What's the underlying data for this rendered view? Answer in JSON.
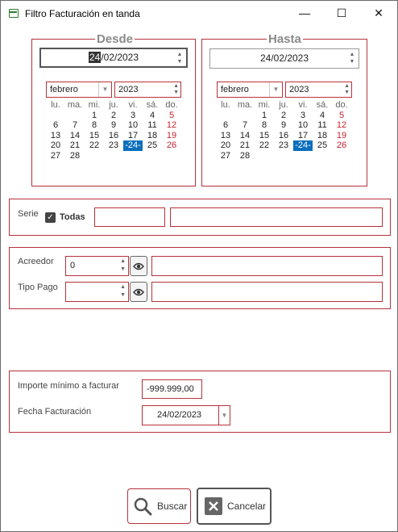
{
  "window": {
    "title": "Filtro Facturación en tanda",
    "minimize_glyph": "—",
    "maximize_glyph": "☐",
    "close_glyph": "✕"
  },
  "desde": {
    "legend": "Desde",
    "date_day": "24",
    "date_rest": "/02/2023",
    "month": "febrero",
    "year": "2023",
    "selected_day": "-24-"
  },
  "hasta": {
    "legend": "Hasta",
    "date": "24/02/2023",
    "month": "febrero",
    "year": "2023",
    "selected_day": "-24-"
  },
  "calendar": {
    "weekdays": [
      "lu.",
      "ma.",
      "mi.",
      "ju.",
      "vi.",
      "sá.",
      "do."
    ],
    "weeks": [
      [
        "",
        "",
        "1",
        "2",
        "3",
        "4",
        "5"
      ],
      [
        "6",
        "7",
        "8",
        "9",
        "10",
        "11",
        "12"
      ],
      [
        "13",
        "14",
        "15",
        "16",
        "17",
        "18",
        "19"
      ],
      [
        "20",
        "21",
        "22",
        "23",
        "24",
        "25",
        "26"
      ],
      [
        "27",
        "28",
        "",
        "",
        "",
        "",
        ""
      ]
    ],
    "sunday_color": "#c8202d",
    "today_color": "#0a6ebd"
  },
  "serie": {
    "label": "Serie",
    "checkbox_label": "Todas",
    "checked": true,
    "code_value": "",
    "name_value": ""
  },
  "acreedor": {
    "label": "Acreedor",
    "value": "0",
    "name_value": ""
  },
  "tipo_pago": {
    "label": "Tipo Pago",
    "value": "",
    "name_value": ""
  },
  "importe": {
    "label": "Importe mínimo a facturar",
    "value": "-999.999,00"
  },
  "fecha_facturacion": {
    "label": "Fecha Facturación",
    "value": "24/02/2023"
  },
  "buttons": {
    "search_label": "Buscar",
    "cancel_label": "Cancelar"
  },
  "colors": {
    "accent_border": "#b5323b",
    "legend_gray": "#8a8a8a"
  }
}
